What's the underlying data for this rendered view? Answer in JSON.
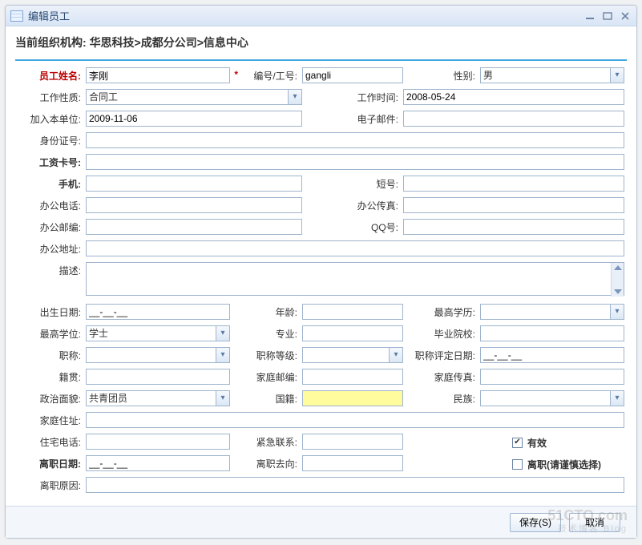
{
  "window": {
    "title": "编辑员工"
  },
  "breadcrumb": {
    "label": "当前组织机构:",
    "path": "华思科技>成都分公司>信息中心"
  },
  "labels": {
    "name": "员工姓名:",
    "code": "编号/工号:",
    "gender": "性别:",
    "workType": "工作性质:",
    "workTime": "工作时间:",
    "joinDate": "加入本单位:",
    "email": "电子邮件:",
    "idcard": "身份证号:",
    "salaryCard": "工资卡号:",
    "mobile": "手机:",
    "shortNo": "短号:",
    "officeTel": "办公电话:",
    "officeFax": "办公传真:",
    "officeZip": "办公邮编:",
    "qq": "QQ号:",
    "officeAddr": "办公地址:",
    "desc": "描述:",
    "birth": "出生日期:",
    "age": "年龄:",
    "edu": "最高学历:",
    "degree": "最高学位:",
    "major": "专业:",
    "school": "毕业院校:",
    "title": "职称:",
    "titleLevel": "职称等级:",
    "titleDate": "职称评定日期:",
    "hometown": "籍贯:",
    "homeZip": "家庭邮编:",
    "homeFax": "家庭传真:",
    "politics": "政治面貌:",
    "nation": "国籍:",
    "ethnic": "民族:",
    "homeAddr": "家庭住址:",
    "homeTel": "住宅电话:",
    "emergency": "紧急联系:",
    "leaveDate": "离职日期:",
    "leaveTo": "离职去向:",
    "leaveReason": "离职原因:",
    "valid": "有效",
    "leave": "离职(请谨慎选择)"
  },
  "values": {
    "name": "李刚",
    "code": "gangli",
    "gender": "男",
    "workType": "合同工",
    "workTime": "2008-05-24",
    "joinDate": "2009-11-06",
    "email": "",
    "idcard": "",
    "salaryCard": "",
    "mobile": "",
    "shortNo": "",
    "officeTel": "",
    "officeFax": "",
    "officeZip": "",
    "qq": "",
    "officeAddr": "",
    "desc": "",
    "birth": "__-__-__",
    "age": "",
    "edu": "",
    "degree": "学士",
    "major": "",
    "school": "",
    "title": "",
    "titleLevel": "",
    "titleDate": "__-__-__",
    "hometown": "",
    "homeZip": "",
    "homeFax": "",
    "politics": "共青团员",
    "nation": "",
    "ethnic": "",
    "homeAddr": "",
    "homeTel": "",
    "emergency": "",
    "leaveDate": "__-__-__",
    "leaveTo": "",
    "leaveReason": ""
  },
  "checks": {
    "valid": true,
    "leave": false
  },
  "footer": {
    "save": "保存(S)",
    "cancel": "取消"
  },
  "watermark": {
    "main": "51CTO.com",
    "sub": "技术博客  Blog"
  }
}
